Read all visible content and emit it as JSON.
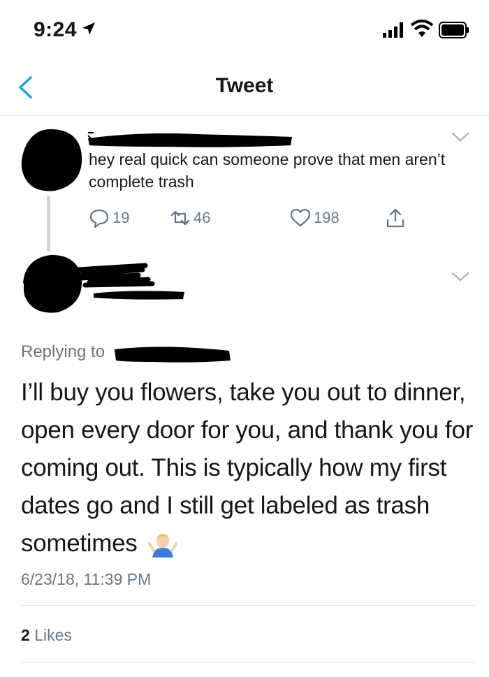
{
  "status_bar": {
    "time": "9:24",
    "icons": [
      "location-arrow-icon",
      "signal-bars-icon",
      "wifi-icon",
      "battery-icon"
    ]
  },
  "nav": {
    "title": "Tweet",
    "back_icon": "chevron-left-icon"
  },
  "parent_tweet": {
    "text": "hey real quick can someone prove that men aren’t complete trash",
    "replies": "19",
    "retweets": "46",
    "likes": "198"
  },
  "main_tweet": {
    "replying_to_label": "Replying to",
    "text": "I’ll buy you flowers, take you out to dinner, open every door for you, and thank you for coming out. This is typically how my first dates go and I still get labeled as trash sometimes",
    "emoji": "person-shrugging-emoji",
    "timestamp": "6/23/18, 11:39 PM",
    "likes_count": "2",
    "likes_label": "Likes"
  },
  "colors": {
    "accent": "#1da1f2",
    "secondary_text": "#657786",
    "divider": "#e1e8ed",
    "redaction": "#000000"
  }
}
